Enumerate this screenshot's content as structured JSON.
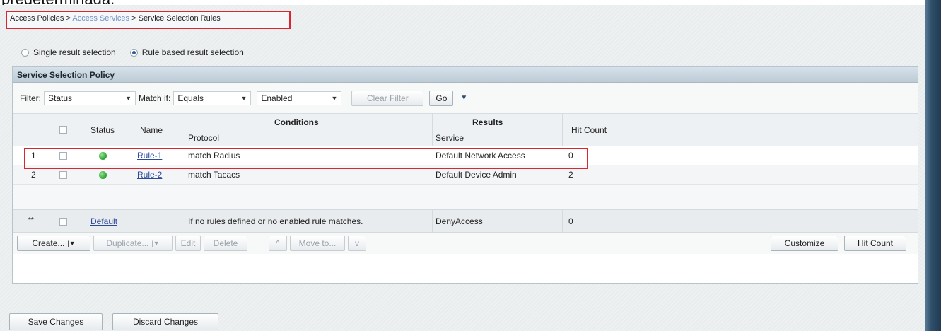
{
  "page": {
    "cut_off_text": "predeterminada."
  },
  "breadcrumb": {
    "item1": "Access Policies",
    "sep": " > ",
    "item2": "Access Services",
    "item3": "Service Selection Rules"
  },
  "selection_mode": {
    "single_label": "Single result selection",
    "rule_label": "Rule based result selection",
    "selected": "rule"
  },
  "panel": {
    "title": "Service Selection Policy"
  },
  "filter": {
    "filter_label": "Filter:",
    "filter_value": "Status",
    "match_label": "Match if:",
    "match_value": "Equals",
    "value_value": "Enabled",
    "clear_label": "Clear Filter",
    "go_label": "Go"
  },
  "table": {
    "headers": {
      "status": "Status",
      "name": "Name",
      "conditions": "Conditions",
      "protocol": "Protocol",
      "results": "Results",
      "service": "Service",
      "hit_count": "Hit Count"
    },
    "rows": [
      {
        "num": "1",
        "name": "Rule-1",
        "protocol": "match Radius",
        "service": "Default Network Access",
        "hits": "0"
      },
      {
        "num": "2",
        "name": "Rule-2",
        "protocol": "match Tacacs",
        "service": "Default Device Admin",
        "hits": "2"
      }
    ],
    "default_row": {
      "marker": "**",
      "name": "Default",
      "condition": "If no rules defined or no enabled rule matches.",
      "service": "DenyAccess",
      "hits": "0"
    }
  },
  "actions": {
    "create": "Create...",
    "duplicate": "Duplicate...",
    "edit": "Edit",
    "delete": "Delete",
    "move_up": "^",
    "move_to": "Move to...",
    "move_down": "v",
    "customize": "Customize",
    "hit_count": "Hit Count"
  },
  "footer": {
    "save": "Save Changes",
    "discard": "Discard Changes"
  },
  "colors": {
    "highlight": "#d9262f",
    "link": "#2c4a9a",
    "status_ok": "#28a032"
  }
}
